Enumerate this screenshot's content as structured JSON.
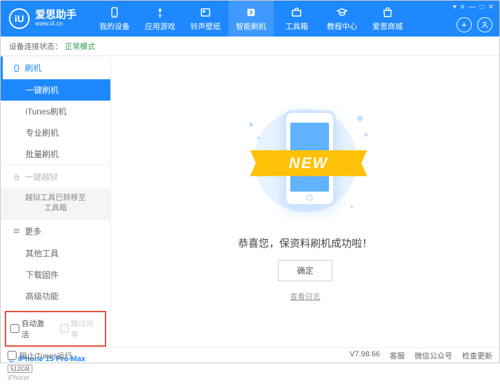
{
  "app": {
    "title": "爱思助手",
    "subtitle": "www.i4.cn",
    "logo_letter": "iU"
  },
  "nav": [
    {
      "label": "我的设备"
    },
    {
      "label": "应用游戏"
    },
    {
      "label": "铃声壁纸"
    },
    {
      "label": "智能刷机"
    },
    {
      "label": "工具箱"
    },
    {
      "label": "教程中心"
    },
    {
      "label": "爱思商城"
    }
  ],
  "status": {
    "label": "设备连接状态：",
    "value": "正常模式"
  },
  "sidebar": {
    "flash": {
      "header": "刷机",
      "items": [
        "一键刷机",
        "iTunes刷机",
        "专业刷机",
        "批量刷机"
      ]
    },
    "jailbreak": {
      "header": "一键越狱",
      "notice": "越狱工具已转移至\n工具箱"
    },
    "more": {
      "header": "更多",
      "items": [
        "其他工具",
        "下载固件",
        "高级功能"
      ]
    }
  },
  "checkboxes": {
    "auto_activate": "自动激活",
    "skip_guide": "跳过向导"
  },
  "device": {
    "name": "iPhone 15 Pro Max",
    "storage": "512GB",
    "type": "iPhone"
  },
  "main": {
    "new_badge": "NEW",
    "success": "恭喜您，保资料刷机成功啦！",
    "confirm": "确定",
    "view_log": "查看日志"
  },
  "footer": {
    "block_itunes": "阻止iTunes运行",
    "version": "V7.98.66",
    "links": [
      "客服",
      "微信公众号",
      "检查更新"
    ]
  }
}
